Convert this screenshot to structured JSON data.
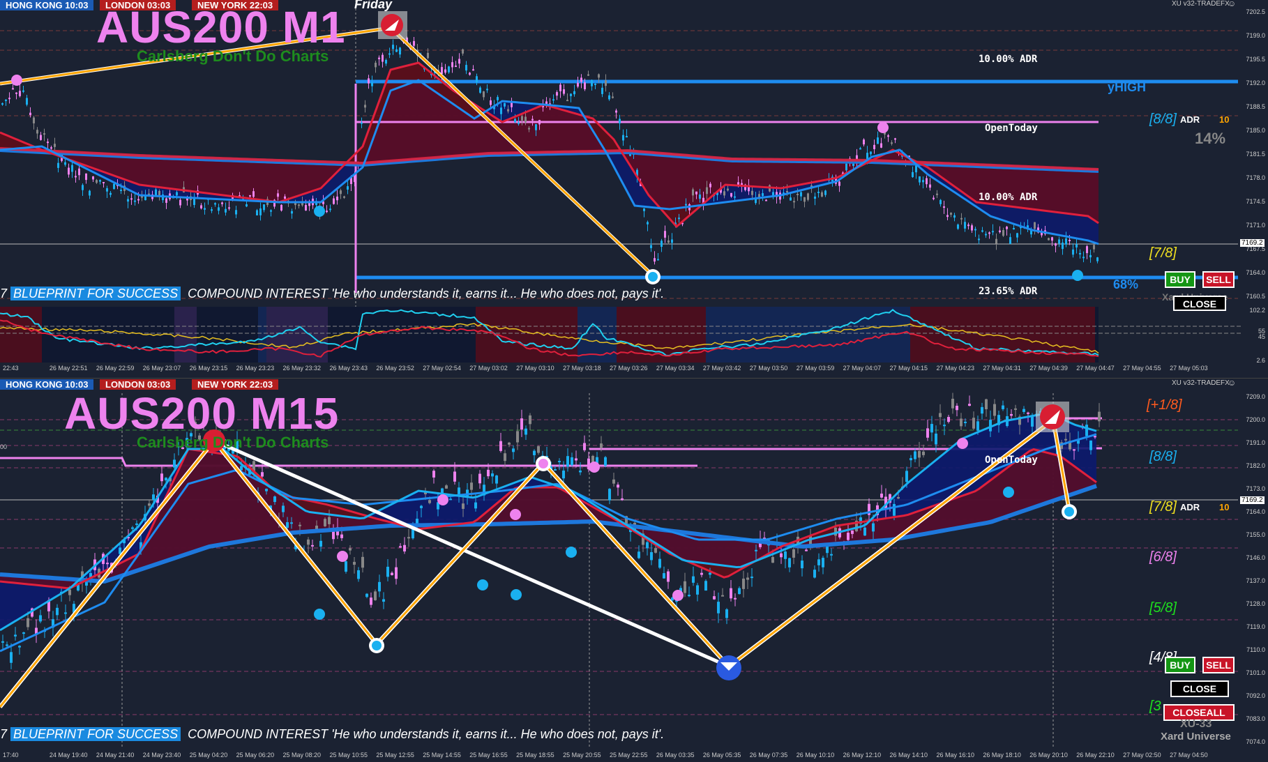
{
  "top": {
    "sessions": [
      "HONG KONG 10:03",
      "LONDON  03:03",
      "NEW YORK  22:03"
    ],
    "title": "AUS200 M1",
    "subtitle": "Carlsberg Don't Do Charts",
    "day_label": "Friday",
    "broker": "XU v32-TRADEFX",
    "adr_upper": "10.00% ADR",
    "adr_mid": "10.00% ADR",
    "adr_low": "23.65% ADR",
    "open_today": "OpenToday",
    "yhigh": "yHIGH",
    "murrey_8": "[8/8]",
    "murrey_7": "[7/8]",
    "adr_label": "ADR",
    "adr_value": "10",
    "pct_a": "14%",
    "pct_b": "68%",
    "ticker_hl": "BLUEPRINT FOR SUCCESS",
    "ticker_prefix": "7",
    "ticker_text": "COMPOUND INTEREST 'He who understands it, earns it... He who does not, pays it'.",
    "buy": "BUY",
    "sell": "SELL",
    "close": "CLOSE",
    "watermark": "Xard Universe",
    "current_price": "7169.2",
    "prices": [
      "7202.5",
      "7199.0",
      "7195.5",
      "7192.0",
      "7188.5",
      "7185.0",
      "7181.5",
      "7178.0",
      "7174.5",
      "7171.0",
      "7167.5",
      "7164.0",
      "7160.5"
    ],
    "osc_scale": [
      "102.2",
      "55",
      "45",
      "2.6"
    ],
    "times": [
      "22:43",
      "26 May 22:51",
      "26 May 22:59",
      "26 May 23:07",
      "26 May 23:15",
      "26 May 23:23",
      "26 May 23:32",
      "26 May 23:43",
      "26 May 23:52",
      "27 May 02:54",
      "27 May 03:02",
      "27 May 03:10",
      "27 May 03:18",
      "27 May 03:26",
      "27 May 03:34",
      "27 May 03:42",
      "27 May 03:50",
      "27 May 03:59",
      "27 May 04:07",
      "27 May 04:15",
      "27 May 04:23",
      "27 May 04:31",
      "27 May 04:39",
      "27 May 04:47",
      "27 May 04:55",
      "27 May 05:03"
    ]
  },
  "bottom": {
    "sessions": [
      "HONG KONG 10:03",
      "LONDON  03:03",
      "NEW YORK  22:03"
    ],
    "title": "AUS200 M15",
    "subtitle": "Carlsberg Don't Do Charts",
    "broker": "XU v32-TRADEFX",
    "open_today": "OpenToday",
    "murrey": [
      "[+1/8]",
      "[8/8]",
      "[7/8]",
      "[6/8]",
      "[5/8]",
      "[4/8]",
      "[3"
    ],
    "adr_label": "ADR",
    "adr_value": "10",
    "ticker_hl": "BLUEPRINT FOR SUCCESS",
    "ticker_prefix": "7",
    "ticker_text": "COMPOUND INTEREST 'He who understands it, earns it... He who does not, pays it'.",
    "buy": "BUY",
    "sell": "SELL",
    "close": "CLOSE",
    "closeall": "CLOSEALL",
    "badge": "XU-33",
    "watermark": "Xard Universe",
    "left_tick": "00",
    "current_price": "7169.2",
    "prices": [
      "7209.0",
      "7200.0",
      "7191.0",
      "7182.0",
      "7173.0",
      "7164.0",
      "7155.0",
      "7146.0",
      "7137.0",
      "7128.0",
      "7119.0",
      "7110.0",
      "7101.0",
      "7092.0",
      "7083.0",
      "7074.0"
    ],
    "times": [
      "17:40",
      "24 May 19:40",
      "24 May 21:40",
      "24 May 23:40",
      "25 May 04:20",
      "25 May 06:20",
      "25 May 08:20",
      "25 May 10:55",
      "25 May 12:55",
      "25 May 14:55",
      "25 May 16:55",
      "25 May 18:55",
      "25 May 20:55",
      "25 May 22:55",
      "26 May 03:35",
      "26 May 05:35",
      "26 May 07:35",
      "26 May 10:10",
      "26 May 12:10",
      "26 May 14:10",
      "26 May 16:10",
      "26 May 18:10",
      "26 May 20:10",
      "26 May 22:10",
      "27 May 02:50",
      "27 May 04:50"
    ]
  },
  "colors": {
    "bg": "#1b2232",
    "bull": "#1ab0f0",
    "bear": "#ee82ee",
    "ma_red": "#e0203c",
    "ma_blue": "#1e8cf0",
    "zigzag": "#ffa500",
    "hk": "#1a5ab4",
    "ldn": "#b41e1e",
    "ny": "#b41e1e"
  }
}
